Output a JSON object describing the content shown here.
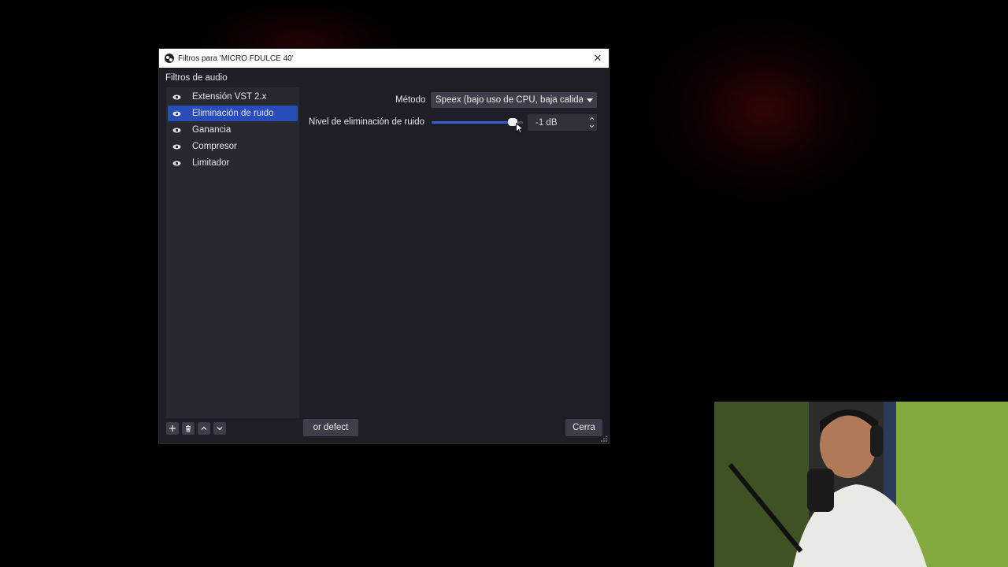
{
  "dialog": {
    "title": "Filtros para 'MICRO FDULCE 40'",
    "close_glyph": "✕",
    "section_label": "Filtros de audio",
    "filters": [
      {
        "label": "Extensión VST 2.x",
        "icon": "eye-icon",
        "selected": false
      },
      {
        "label": "Eliminación de ruido",
        "icon": "eye-icon",
        "selected": true
      },
      {
        "label": "Ganancia",
        "icon": "eye-icon",
        "selected": false
      },
      {
        "label": "Compresor",
        "icon": "eye-icon",
        "selected": false
      },
      {
        "label": "Limitador",
        "icon": "eye-icon",
        "selected": false
      }
    ],
    "toolbar_icons": [
      "plus-icon",
      "trash-icon",
      "chevron-up-icon",
      "chevron-down-icon"
    ],
    "properties": {
      "method_label": "Método",
      "method_value": "Speex (bajo uso de CPU, baja calidad",
      "noise_level_label": "Nivel de eliminación de ruido",
      "noise_level_value": "-1 dB",
      "slider_fraction": 0.93
    },
    "defaults_button": "or defect",
    "close_button": "Cerra"
  },
  "colors": {
    "selection": "#284cb8",
    "slider_fill": "#3a5fd6",
    "dialog_bg": "#1e1f26"
  }
}
